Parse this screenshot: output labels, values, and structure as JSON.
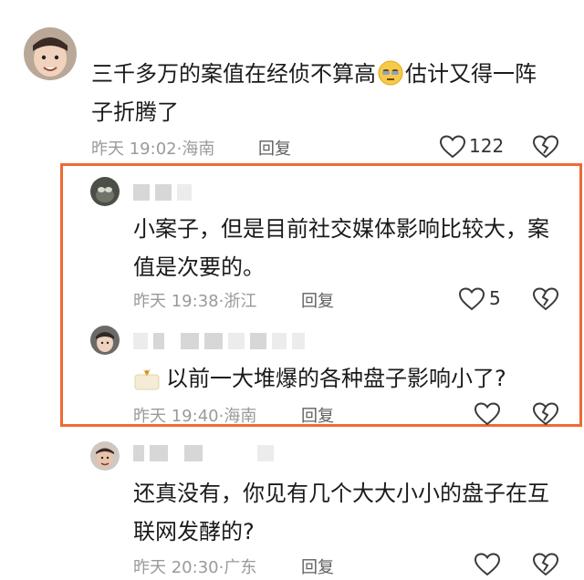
{
  "comments": [
    {
      "text_before_emoji": "三千多万的案值在经侦不算高",
      "text_after_emoji": "估计又得一阵",
      "text_line2": "子折腾了",
      "time": "昨天 19:02",
      "location": "海南",
      "reply_label": "回复",
      "like_count": "122"
    },
    {
      "text_line1": "小案子，但是目前社交媒体影响比较大，案",
      "text_line2": "值是次要的。",
      "time": "昨天 19:38",
      "location": "浙江",
      "reply_label": "回复",
      "like_count": "5"
    },
    {
      "text": "以前一大堆爆的各种盘子影响小了?",
      "time": "昨天 19:40",
      "location": "海南",
      "reply_label": "回复"
    },
    {
      "text_line1": "还真没有，你见有几个大大小小的盘子在互",
      "text_line2": "联网发酵的?",
      "time": "昨天 20:30",
      "location": "广东",
      "reply_label": "回复"
    }
  ],
  "separator": "·",
  "colors": {
    "highlight_border": "#ee6a35",
    "meta_text": "#9a9a9a"
  },
  "icons": [
    "heart-icon",
    "broken-heart-icon",
    "sleepy-face-emoji",
    "sticker-icon"
  ]
}
